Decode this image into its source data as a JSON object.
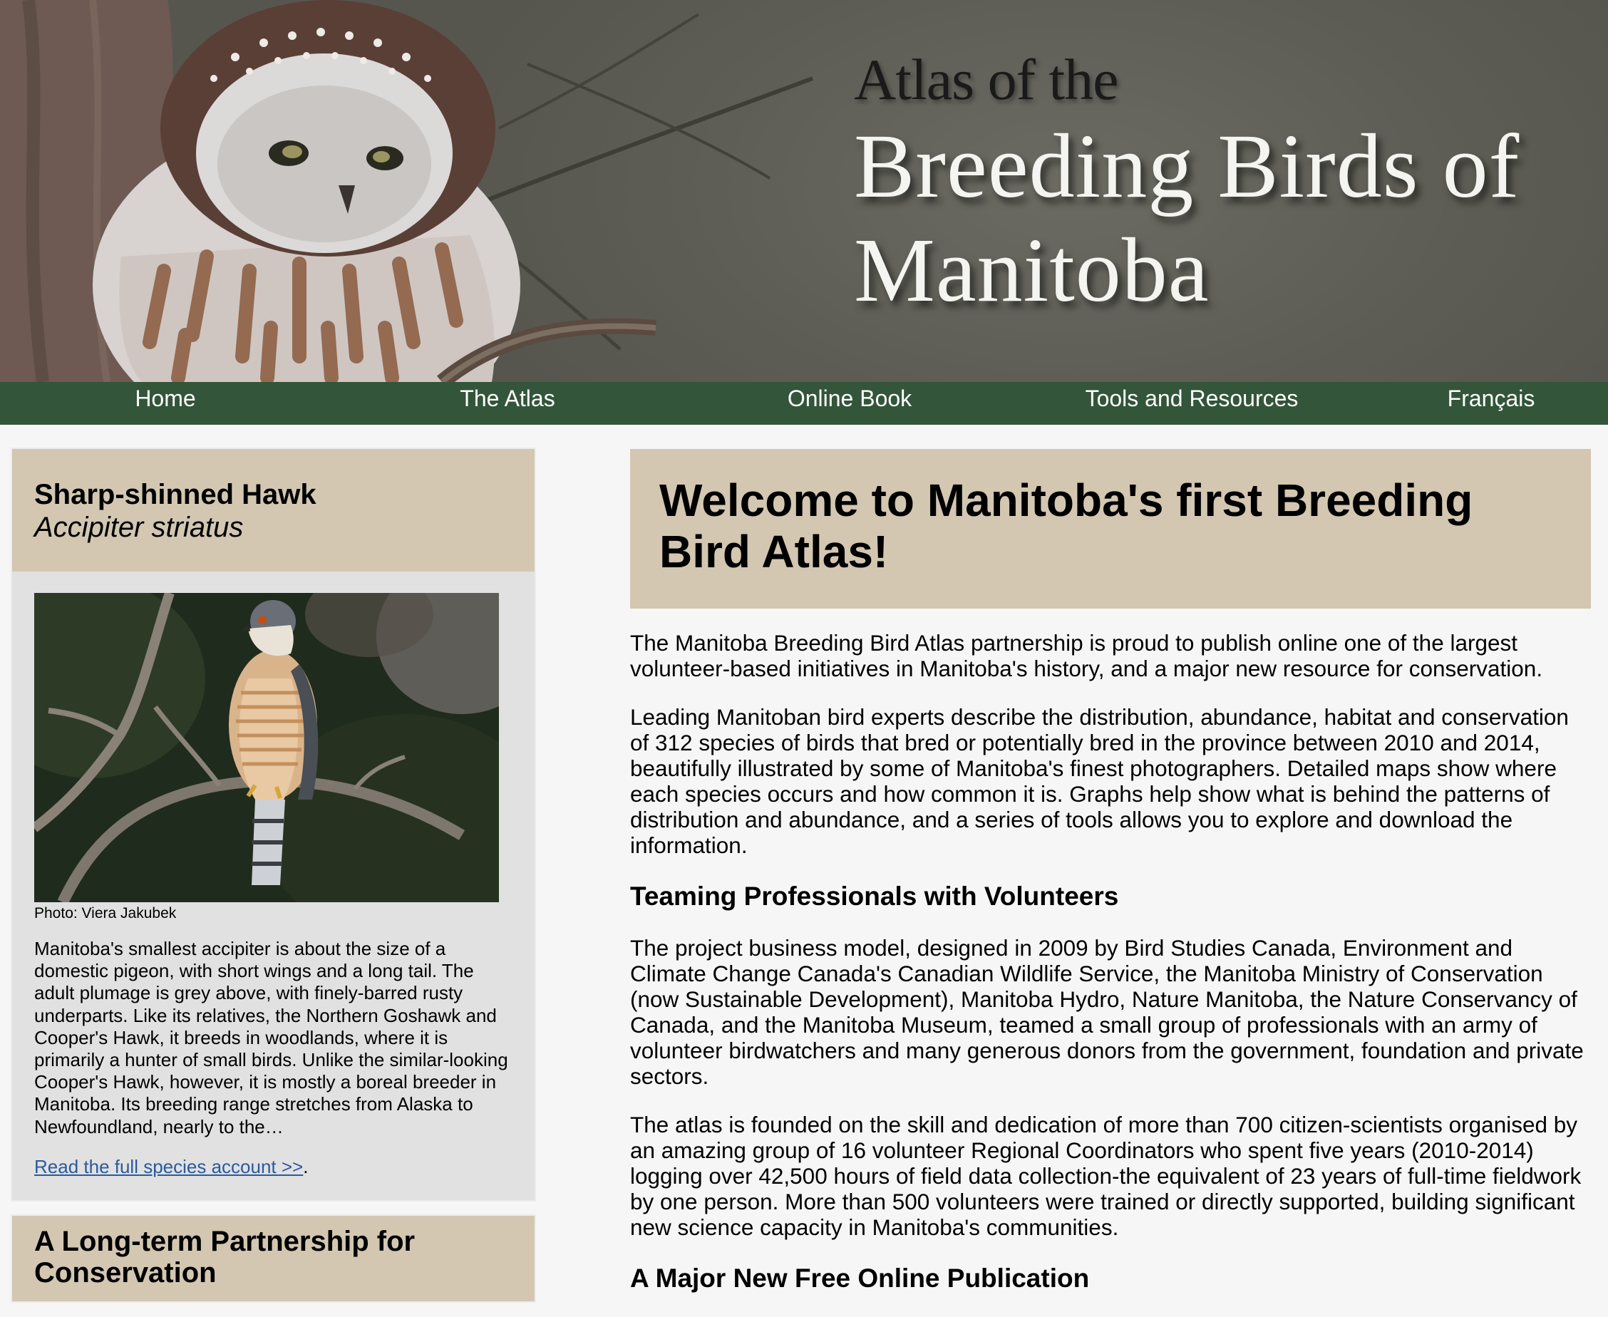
{
  "banner": {
    "title_small": "Atlas of the",
    "title_line1": "Breeding Birds of",
    "title_line2": "Manitoba",
    "image_subject": "owl-photo"
  },
  "nav": {
    "items": [
      {
        "label": "Home"
      },
      {
        "label": "The Atlas"
      },
      {
        "label": "Online Book"
      },
      {
        "label": "Tools and Resources"
      },
      {
        "label": "Français"
      }
    ]
  },
  "featured_species": {
    "common_name": "Sharp-shinned Hawk",
    "latin_name": "Accipiter striatus",
    "photo_credit": "Photo: Viera Jakubek",
    "description": "Manitoba's smallest accipiter is about the size of a domestic pigeon, with short wings and a long tail. The adult plumage is grey above, with finely-barred rusty underparts. Like its relatives, the Northern Goshawk and Cooper's Hawk, it breeds in woodlands, where it is primarily a hunter of small birds. Unlike the similar-looking Cooper's Hawk, however, it is mostly a boreal breeder in Manitoba. Its breeding range stretches from Alaska to Newfoundland, nearly to the…",
    "read_more_label": "Read the full species account >>",
    "read_more_suffix": "."
  },
  "partnership_card": {
    "heading": "A Long-term Partnership for Conservation"
  },
  "main": {
    "heading": "Welcome to Manitoba's first Breeding Bird Atlas!",
    "para1": "The Manitoba Breeding Bird Atlas partnership is proud to publish online one of the largest volunteer-based initiatives in Manitoba's history, and a major new resource for conservation.",
    "para2": "Leading Manitoban bird experts describe the distribution, abundance, habitat and conservation of 312 species of birds that bred or potentially bred in the province between 2010 and 2014, beautifully illustrated by some of Manitoba's finest photographers. Detailed maps show where each species occurs and how common it is. Graphs help show what is behind the patterns of distribution and abundance, and a series of tools allows you to explore and download the information.",
    "subheading1": "Teaming Professionals with Volunteers",
    "para3": "The project business model, designed in 2009 by Bird Studies Canada, Environment and Climate Change Canada's Canadian Wildlife Service, the Manitoba Ministry of Conservation (now Sustainable Development), Manitoba Hydro, Nature Manitoba, the Nature Conservancy of Canada, and the Manitoba Museum, teamed a small group of professionals with an army of volunteer birdwatchers and many generous donors from the government, foundation and private sectors.",
    "para4": "The atlas is founded on the skill and dedication of more than 700 citizen-scientists organised by an amazing group of 16 volunteer Regional Coordinators who spent five years (2010-2014) logging over 42,500 hours of field data collection-the equivalent of 23 years of full-time fieldwork by one person. More than 500 volunteers were trained or directly supported, building significant new science capacity in Manitoba's communities.",
    "subheading2": "A Major New Free Online Publication"
  },
  "colors": {
    "nav_bg": "#33553a",
    "card_tan": "#d3c7b2",
    "card_grey": "#e1e1e1",
    "link": "#2a5a9e",
    "page_bg": "#f6f6f6"
  }
}
